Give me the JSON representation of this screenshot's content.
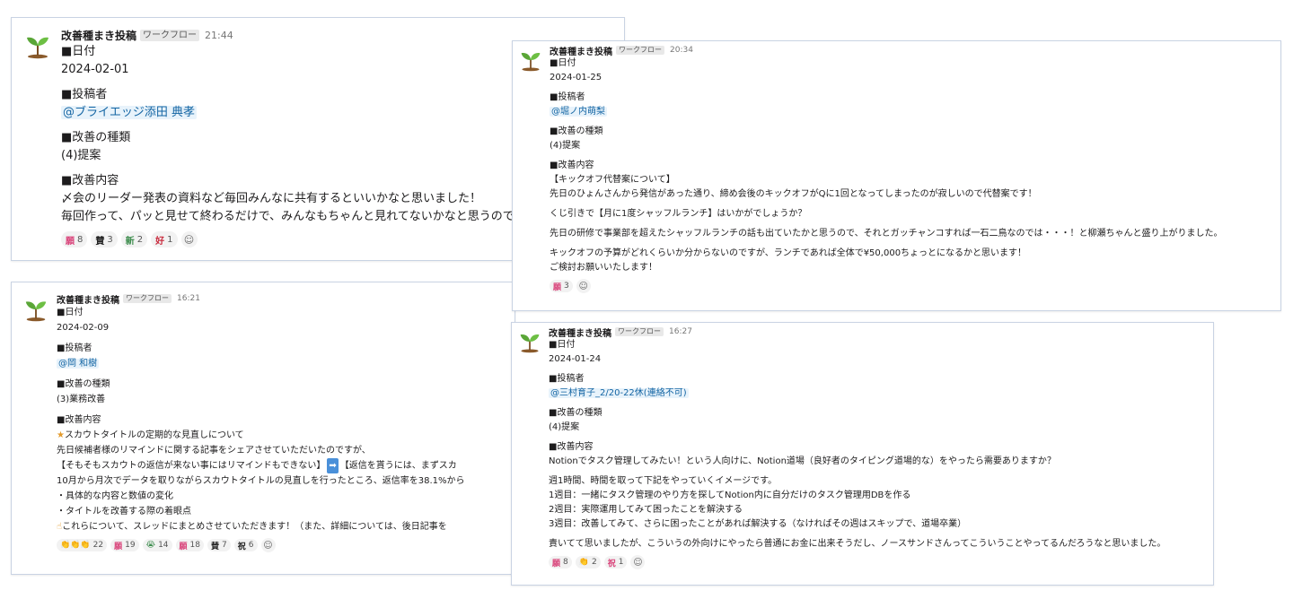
{
  "accent_colors": {
    "mention_text": "#1264a3",
    "mention_bg": "#e8f3fb",
    "card_border": "#c9d3e3",
    "sprout_green": "#5aa637",
    "sprout_stem": "#8a5a2b"
  },
  "card_a": {
    "author": "改善種まき投稿",
    "badge": "ワークフロー",
    "time": "21:44",
    "date_label": "■日付",
    "date_value": "2024-02-01",
    "poster_label": "■投稿者",
    "poster_value": "@ブライエッジ添田 典孝",
    "type_label": "■改善の種類",
    "type_value": "(4)提案",
    "content_label": "■改善内容",
    "content_lines": [
      "〆会のリーダー発表の資料など毎回みんなに共有するといいかなと思いました！",
      "毎回作って、パッと見せて終わるだけで、みんなもちゃんと見れてないかなと思うので"
    ],
    "reactions": [
      {
        "emoji": "願",
        "count": "8",
        "icon": "pink-kanji-emoji"
      },
      {
        "emoji": "賛",
        "count": "3",
        "icon": "dark-kanji-emoji"
      },
      {
        "emoji": "新",
        "count": "2",
        "icon": "green-kanji-emoji"
      },
      {
        "emoji": "好",
        "count": "1",
        "icon": "red-kanji-emoji"
      }
    ]
  },
  "card_b": {
    "author": "改善種まき投稿",
    "badge": "ワークフロー",
    "time": "20:34",
    "date_label": "■日付",
    "date_value": "2024-01-25",
    "poster_label": "■投稿者",
    "poster_value": "@堀ノ内萌梨",
    "type_label": "■改善の種類",
    "type_value": "(4)提案",
    "content_label": "■改善内容",
    "content_lines": [
      "【キックオフ代替案について】",
      "先日のひょんさんから発信があった通り、締め会後のキックオフがQに1回となってしまったのが寂しいので代替案です！"
    ],
    "content_para2": "くじ引きで【月に1度シャッフルランチ】はいかがでしょうか？",
    "content_para3": "先日の研修で事業部を超えたシャッフルランチの話も出ていたかと思うので、それとガッチャンコすれば一石二鳥なのでは・・・！と柳瀬ちゃんと盛り上がりました。",
    "content_para4": [
      "キックオフの予算がどれくらいか分からないのですが、ランチであれば全体で¥50,000ちょっとになるかと思います！",
      "ご検討お願いいたします！"
    ],
    "reactions": [
      {
        "emoji": "願",
        "count": "3",
        "icon": "pink-kanji-emoji"
      }
    ]
  },
  "card_c": {
    "author": "改善種まき投稿",
    "badge": "ワークフロー",
    "time": "16:21",
    "date_label": "■日付",
    "date_value": "2024-02-09",
    "poster_label": "■投稿者",
    "poster_value": "@岡 和樹",
    "type_label": "■改善の種類",
    "type_value": "(3)業務改善",
    "content_label": "■改善内容",
    "content_lines": [
      "スカウトタイトルの定期的な見直しについて",
      "先日候補者様のリマインドに関する記事をシェアさせていただいたのですが、",
      "【そもそもスカウトの返信が来ない事にはリマインドもできない】",
      "【返信を貰うには、まずスカ",
      "10月から月次でデータを取りながらスカウトタイトルの見直しを行ったところ、返信率を38.1%から",
      "・具体的な内容と数値の変化",
      "・タイトルを改善する際の着眼点",
      "これらについて、スレッドにまとめさせていただきます！（また、詳細については、後日記事を"
    ],
    "reactions": [
      {
        "emoji": "👏👏👏",
        "count": "22",
        "icon": "clap-emoji"
      },
      {
        "emoji": "願",
        "count": "19",
        "icon": "pink-kanji-emoji"
      },
      {
        "emoji": "😭",
        "count": "14",
        "icon": "crying-face-emoji"
      },
      {
        "emoji": "願",
        "count": "18",
        "icon": "pink-kanji-emoji"
      },
      {
        "emoji": "賛",
        "count": "7",
        "icon": "dark-kanji-emoji"
      },
      {
        "emoji": "祝",
        "count": "6",
        "icon": "dark-kanji-emoji"
      }
    ]
  },
  "card_d": {
    "author": "改善種まき投稿",
    "badge": "ワークフロー",
    "time": "16:27",
    "date_label": "■日付",
    "date_value": "2024-01-24",
    "poster_label": "■投稿者",
    "poster_value": "@三村育子_2/20-22休(連絡不可)",
    "type_label": "■改善の種類",
    "type_value": "(4)提案",
    "content_label": "■改善内容",
    "content_para1": "Notionでタスク管理してみたい！という人向けに、Notion道場（良好者のタイピング道場的な）をやったら需要ありますか？",
    "content_lines": [
      "週1時間、時間を取って下記をやっていくイメージです。",
      "1週目：一緒にタスク管理のやり方を探してNotion内に自分だけのタスク管理用DBを作る",
      "2週目：実際運用してみて困ったことを解決する",
      "3週目：改善してみて、さらに困ったことがあれば解決する（なければその週はスキップで、道場卒業）"
    ],
    "content_para3": "責いてて思いましたが、こういうの外向けにやったら普通にお金に出来そうだし、ノースサンドさんってこういうことやってるんだろうなと思いました。",
    "reactions": [
      {
        "emoji": "願",
        "count": "8",
        "icon": "pink-kanji-emoji"
      },
      {
        "emoji": "👏",
        "count": "2",
        "icon": "clap-emoji"
      },
      {
        "emoji": "祝",
        "count": "1",
        "icon": "pink-kanji-emoji"
      }
    ]
  },
  "add_reaction_icon": "add-emoji-icon"
}
